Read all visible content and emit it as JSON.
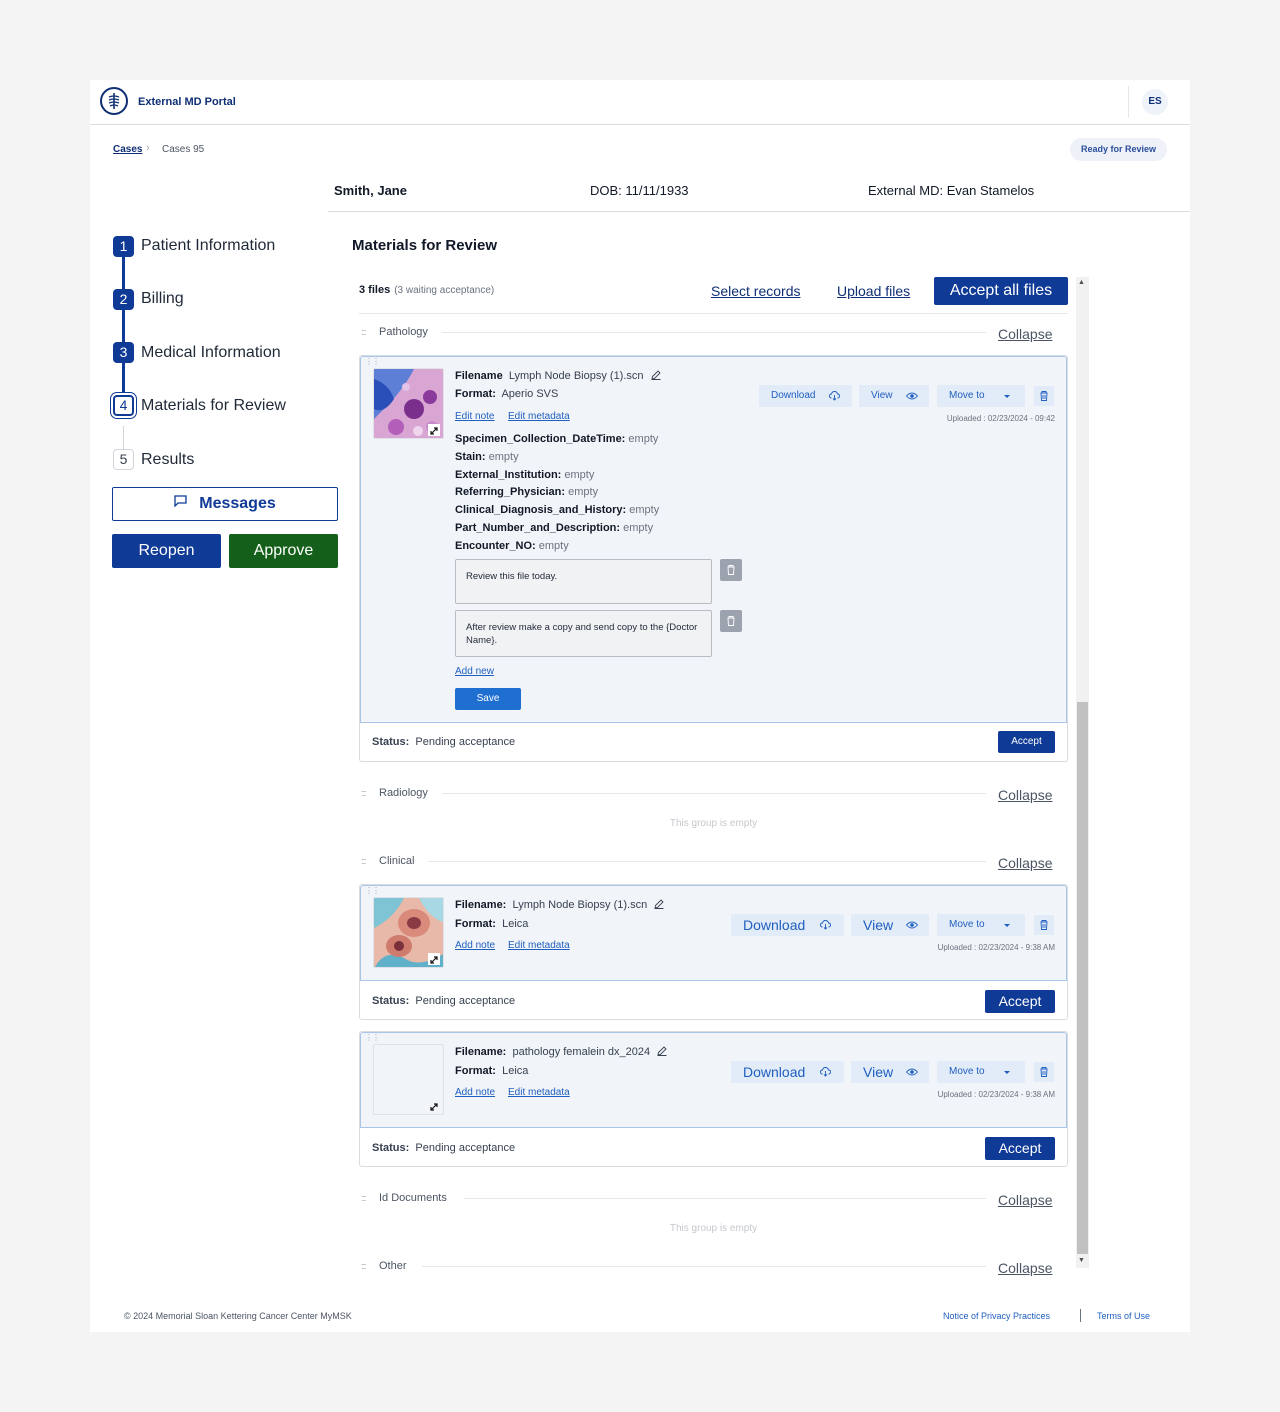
{
  "header": {
    "portal_name": "External MD Portal",
    "user_initials": "ES"
  },
  "breadcrumb": {
    "root": "Cases",
    "current": "Cases 95"
  },
  "case_status": "Ready for Review",
  "patient": {
    "name": "Smith, Jane",
    "dob": "DOB: 11/11/1933",
    "external_md": "External MD: Evan Stamelos"
  },
  "steps": [
    {
      "num": "1",
      "label": "Patient Information",
      "state": "done"
    },
    {
      "num": "2",
      "label": "Billing",
      "state": "done"
    },
    {
      "num": "3",
      "label": "Medical Information",
      "state": "done"
    },
    {
      "num": "4",
      "label": "Materials for Review",
      "state": "active"
    },
    {
      "num": "5",
      "label": "Results",
      "state": "todo"
    }
  ],
  "actions": {
    "messages": "Messages",
    "reopen": "Reopen",
    "approve": "Approve"
  },
  "materials": {
    "title": "Materials for Review",
    "files_count": "3 files",
    "waiting": "(3 waiting acceptance)",
    "select_records": "Select records",
    "upload_files": "Upload files",
    "accept_all": "Accept all files"
  },
  "collapse_label": "Collapse",
  "empty_group_text": "This group is empty",
  "groups": {
    "pathology": "Pathology",
    "radiology": "Radiology",
    "clinical": "Clinical",
    "id_documents": "Id Documents",
    "other": "Other"
  },
  "file_actions": {
    "download": "Download",
    "view": "View",
    "move_to": "Move to",
    "edit_note": "Edit note",
    "add_note": "Add note",
    "edit_metadata": "Edit metadata",
    "add_new": "Add new",
    "save": "Save",
    "accept": "Accept"
  },
  "status_label": "Status:",
  "files": [
    {
      "filename_label": "Filename",
      "filename": "Lymph Node Biopsy (1).scn",
      "format_label": "Format:",
      "format": "Aperio SVS",
      "uploaded": "Uploaded : 02/23/2024 - 09:42",
      "status": "Pending acceptance",
      "metadata": [
        {
          "key": "Specimen_Collection_DateTime:",
          "value": "empty"
        },
        {
          "key": "Stain:",
          "value": "empty"
        },
        {
          "key": "External_Institution:",
          "value": "empty"
        },
        {
          "key": "Referring_Physician:",
          "value": "empty"
        },
        {
          "key": "Clinical_Diagnosis_and_History:",
          "value": "empty"
        },
        {
          "key": "Part_Number_and_Description:",
          "value": "empty"
        },
        {
          "key": "Encounter_NO:",
          "value": "empty"
        }
      ],
      "notes": [
        "Review this file today.",
        "After review make a copy and send copy to the {Doctor Name}."
      ]
    },
    {
      "filename_label": "Filename:",
      "filename": "Lymph Node Biopsy (1).scn",
      "format_label": "Format:",
      "format": "Leica",
      "uploaded": "Uploaded : 02/23/2024 - 9:38 AM",
      "status": "Pending acceptance"
    },
    {
      "filename_label": "Filename:",
      "filename": "pathology femalein dx_2024",
      "format_label": "Format:",
      "format": "Leica",
      "uploaded": "Uploaded : 02/23/2024 - 9:38 AM",
      "status": "Pending acceptance"
    }
  ],
  "footer": {
    "copyright": "© 2024 Memorial Sloan Kettering Cancer Center MyMSK",
    "privacy": "Notice of Privacy Practices",
    "terms": "Terms of Use"
  },
  "colors": {
    "primary": "#0f3a96",
    "approve": "#14601a",
    "link": "#1f5fbf",
    "card_highlight": "#f1f4f8"
  },
  "icons": [
    "logo-icon",
    "chevron-right-icon",
    "message-icon",
    "pencil-icon",
    "cloud-download-icon",
    "eye-icon",
    "caret-down-icon",
    "trash-icon",
    "expand-icon",
    "drag-handle-icon"
  ]
}
